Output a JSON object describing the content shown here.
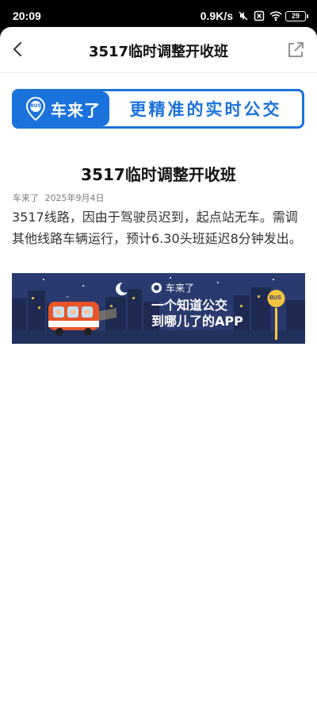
{
  "status_bar": {
    "time": "20:09",
    "network_speed": "0.9K/s",
    "battery": "29"
  },
  "nav": {
    "title": "3517临时调整开收班"
  },
  "brand_banner": {
    "brand_name": "车来了",
    "slogan": "更精准的实时公交",
    "badge": "BUS"
  },
  "article": {
    "title": "3517临时调整开收班",
    "source": "车来了",
    "date": "2025年9月4日",
    "body": "3517线路，因由于驾驶员迟到，起点站无车。需调其他线路车辆运行，预计6.30头班延迟8分钟发出。"
  },
  "ad_banner": {
    "brand_name": "车来了",
    "line1": "一个知道公交",
    "line2": "到哪儿了的APP",
    "stop_sign": "BUS"
  },
  "colors": {
    "accent": "#1a72dc",
    "ad_background": "#2b3a6e",
    "bus_orange": "#e8562a"
  }
}
